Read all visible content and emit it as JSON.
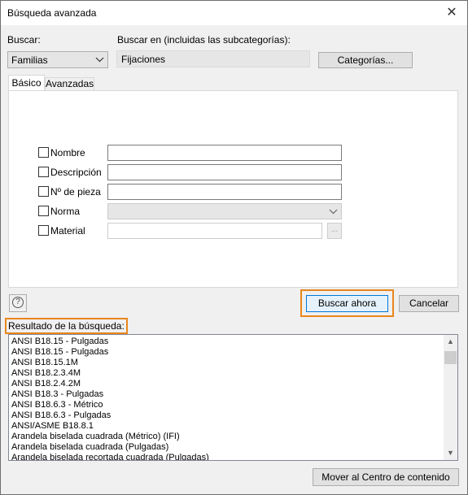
{
  "window": {
    "title": "Búsqueda avanzada",
    "close_glyph": "✕"
  },
  "buscar": {
    "label": "Buscar:",
    "value": "Familias"
  },
  "buscar_en": {
    "label": "Buscar en (incluidas las subcategorías):",
    "value": "Fijaciones"
  },
  "categorias_button": "Categorías...",
  "tabs": [
    {
      "label": "Básico",
      "selected": true
    },
    {
      "label": "Avanzadas",
      "selected": false
    }
  ],
  "criteria": {
    "nombre": "Nombre",
    "descripcion": "Descripción",
    "pieza": "Nº de pieza",
    "norma": "Norma",
    "material": "Material",
    "material_browse": "..."
  },
  "help_glyph": "?",
  "buttons": {
    "search": "Buscar ahora",
    "cancel": "Cancelar",
    "move": "Mover al Centro de contenido"
  },
  "results": {
    "label": "Resultado de la búsqueda:",
    "items": [
      "ANSI B18.15 - Pulgadas",
      "ANSI B18.15 - Pulgadas",
      "ANSI B18.15.1M",
      "ANSI B18.2.3.4M",
      "ANSI B18.2.4.2M",
      "ANSI B18.3 - Pulgadas",
      "ANSI B18.6.3 - Métrico",
      "ANSI B18.6.3 - Pulgadas",
      "ANSI/ASME B18.8.1",
      "Arandela biselada cuadrada (Métrico) (IFI)",
      "Arandela biselada cuadrada (Pulgadas)",
      "Arandela biselada recortada cuadrada (Pulgadas)"
    ]
  },
  "colors": {
    "accent_outline": "#e8861c",
    "primary_border": "#0078d7"
  }
}
